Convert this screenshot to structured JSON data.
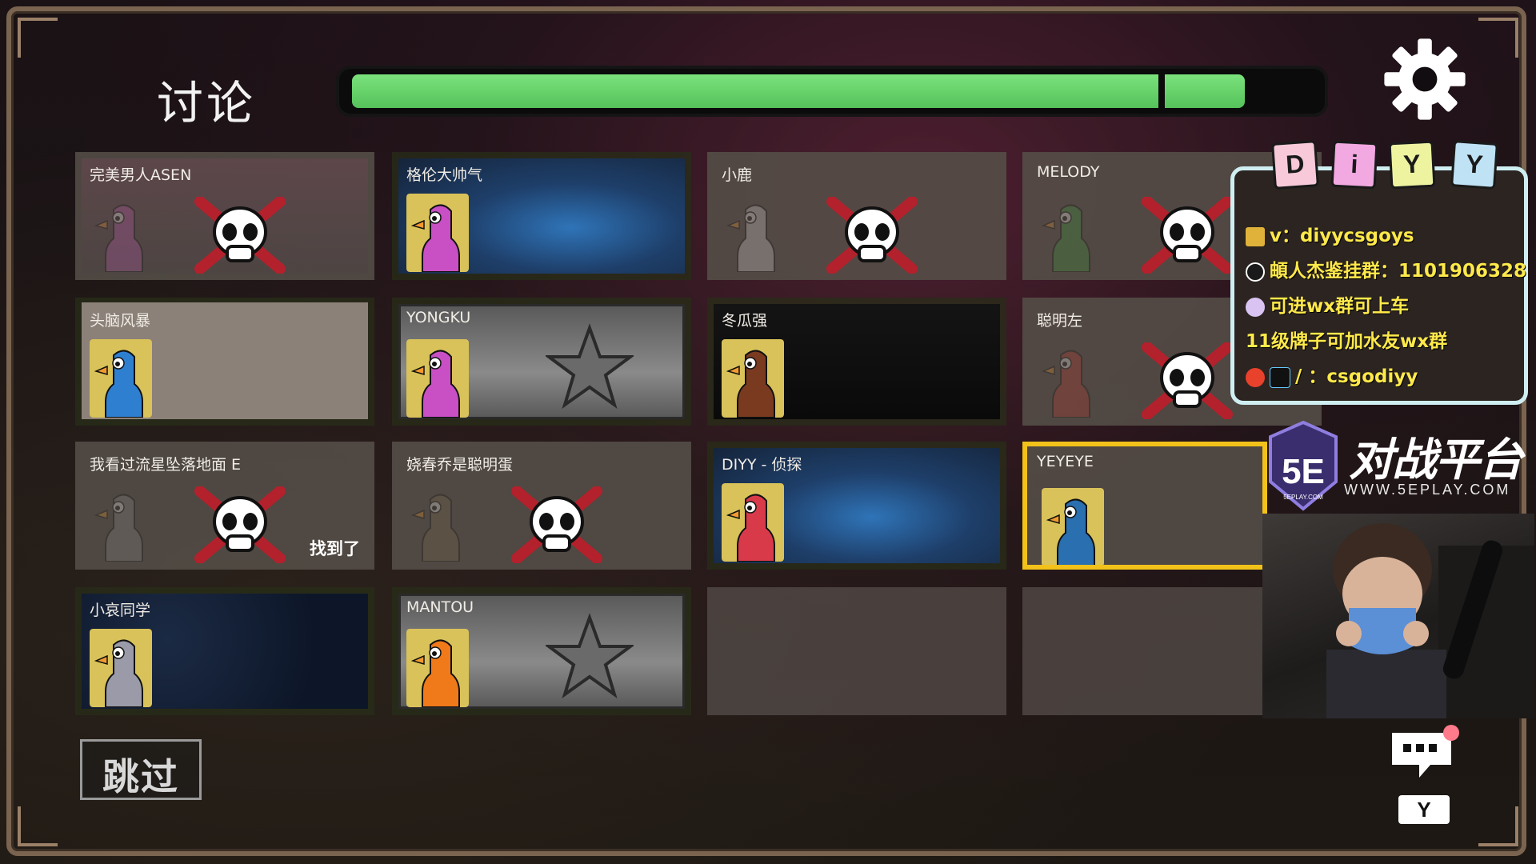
{
  "header": {
    "title": "讨论",
    "timer_progress": 0.93
  },
  "skip_label": "跳过",
  "found_label": "找到了",
  "players": [
    {
      "name": "完美男人ASEN",
      "status": "dead",
      "color": "#c05bb0"
    },
    {
      "name": "格伦大帅气",
      "status": "alive",
      "color": "#c84fc4"
    },
    {
      "name": "小鹿",
      "status": "dead",
      "color": "#d9d9d9"
    },
    {
      "name": "MELODY",
      "status": "dead",
      "color": "#3a9a3a"
    },
    {
      "name": "头脑风暴",
      "status": "alive",
      "color": "#2f7fd0"
    },
    {
      "name": "YONGKU",
      "status": "voted",
      "color": "#c84fc4"
    },
    {
      "name": "冬瓜强",
      "status": "alive",
      "color": "#7a3a20"
    },
    {
      "name": "聪明左",
      "status": "dead",
      "color": "#c0392b"
    },
    {
      "name": "我看过流星坠落地面 E",
      "status": "dead",
      "color": "#888888"
    },
    {
      "name": "娆春乔是聪明蛋",
      "status": "dead",
      "color": "#7a6a4a"
    },
    {
      "name": "DIYY - 侦探",
      "status": "alive",
      "color": "#d83a4a"
    },
    {
      "name": "YEYEYE",
      "status": "alive_self",
      "color": "#2a6fb0"
    },
    {
      "name": "小哀同学",
      "status": "alive",
      "color": "#9a9aa8"
    },
    {
      "name": "MANTOU",
      "status": "voted",
      "color": "#f07a1a"
    }
  ],
  "overlay": {
    "tags": [
      "D",
      "i",
      "Y",
      "Y"
    ],
    "lines": [
      "v：diyycsgoys",
      "頔人杰鉴挂群：1101906328",
      "可进wx群可上车",
      "11级牌子可加水友wx群",
      "/ ：csgodiyy"
    ],
    "logo_text": "5E",
    "logo_sub": "5EPLAY.COM",
    "platform": "对战平台",
    "url": "WWW.5EPLAY.COM",
    "button_label": "Y"
  }
}
